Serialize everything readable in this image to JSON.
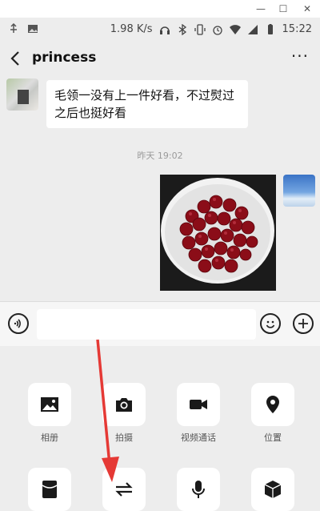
{
  "window": {
    "minimize_glyph": "—",
    "maximize_glyph": "☐",
    "close_glyph": "✕"
  },
  "status_bar": {
    "speed": "1.98 K/s",
    "time": "15:22",
    "icons_left": [
      "usb-icon",
      "image-icon"
    ],
    "icons_right": [
      "headphones-icon",
      "bluetooth-icon",
      "vibrate-icon",
      "alarm-icon",
      "wifi-icon",
      "signal-icon",
      "battery-icon"
    ]
  },
  "header": {
    "title": "princess",
    "more_glyph": "···"
  },
  "chat": {
    "messages": [
      {
        "side": "left",
        "text": "毛领一没有上一件好看，不过熨过之后也挺好看"
      },
      {
        "side": "right",
        "type": "image",
        "description": "cherries-in-white-bowl"
      }
    ],
    "timestamp": "昨天 19:02"
  },
  "panel": {
    "row1": [
      {
        "label": "相册",
        "icon": "album-icon"
      },
      {
        "label": "拍摄",
        "icon": "camera-icon"
      },
      {
        "label": "视频通话",
        "icon": "video-call-icon"
      },
      {
        "label": "位置",
        "icon": "location-icon"
      }
    ],
    "row2": [
      {
        "label": "",
        "icon": "red-packet-icon"
      },
      {
        "label": "",
        "icon": "transfer-icon"
      },
      {
        "label": "",
        "icon": "voice-input-icon"
      },
      {
        "label": "",
        "icon": "favorites-icon"
      }
    ]
  },
  "colors": {
    "background": "#ededed",
    "bubble": "#ffffff",
    "arrow": "#e53935"
  }
}
